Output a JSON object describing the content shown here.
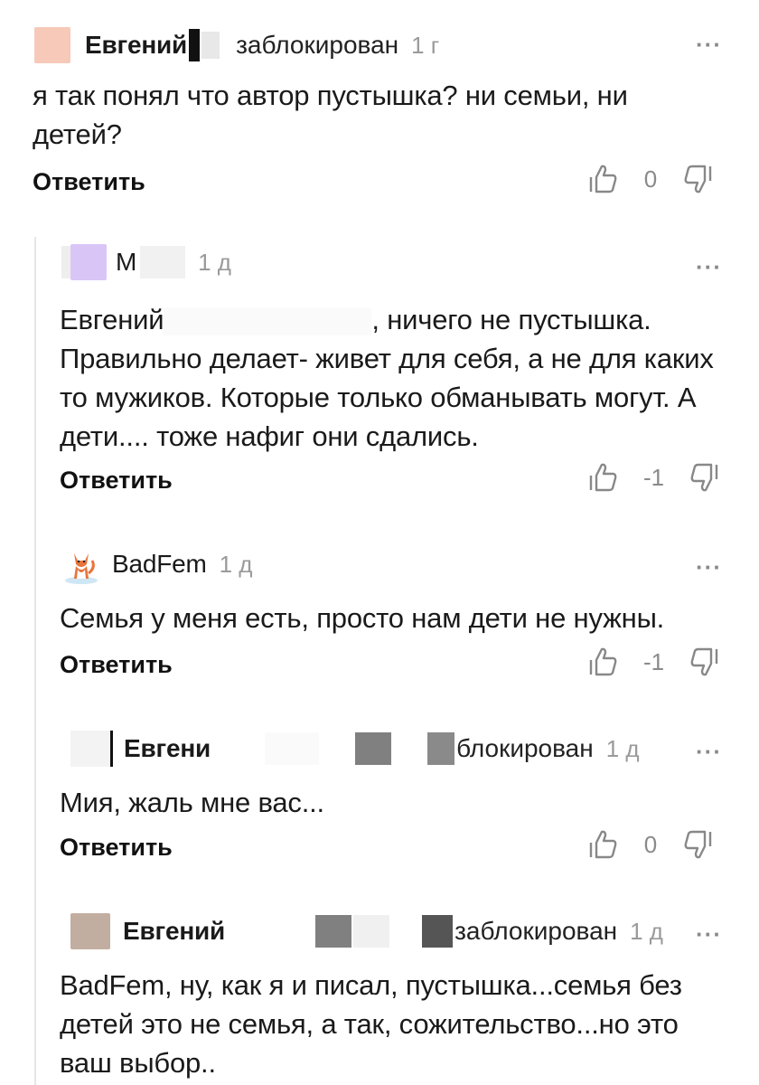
{
  "ui": {
    "reply_label": "Ответить",
    "more_label": "···"
  },
  "comments": [
    {
      "author": "Евгений",
      "status": "заблокирован",
      "time": "1 г",
      "text": "я так понял что автор пустышка? ни семьи, ни детей?",
      "votes": "0"
    },
    {
      "author": "М",
      "status": "",
      "time": "1 д",
      "text_prefix": "Евгений",
      "text_suffix": ", ничего не пустышка.",
      "text": "Правильно делает- живет для себя, а не для каких то мужиков. Которые только обманывать могут. А дети.... тоже нафиг они сдались.",
      "votes": "-1"
    },
    {
      "author": "BadFem",
      "status": "",
      "time": "1 д",
      "text": "Семья у меня есть, просто нам дети не нужны.",
      "votes": "-1"
    },
    {
      "author": "Евгени",
      "status": "блокирован",
      "time": "1 д",
      "text": "Мия, жаль мне вас...",
      "votes": "0"
    },
    {
      "author": "Евгений",
      "status": "заблокирован",
      "time": "1 д",
      "text": "BadFem, ну, как я и писал, пустышка...семья без детей это не семья, а так, сожительство...но это ваш выбор.."
    }
  ],
  "colors": {
    "avatar1": "#f6c9b8",
    "avatar2": "#d9c6f7",
    "avatar5": "#c2aea0"
  }
}
